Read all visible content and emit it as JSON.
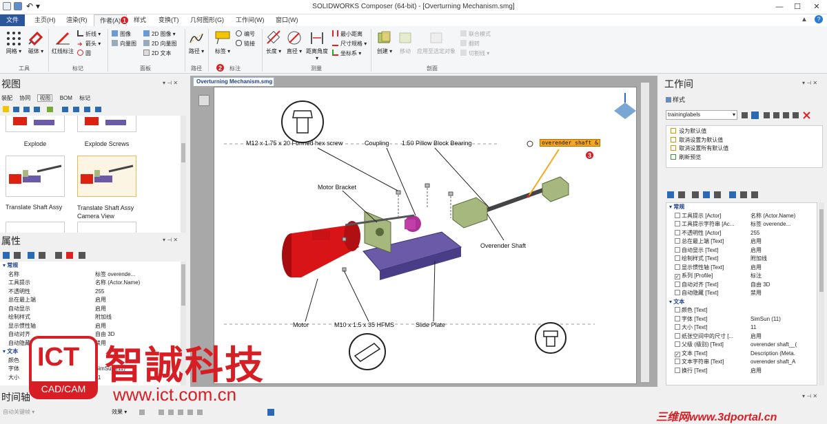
{
  "window": {
    "title": "SOLIDWORKS Composer (64-bit) - [Overturning Mechanism.smg]"
  },
  "menu": {
    "tabs": [
      "文件",
      "主页(H)",
      "渲染(R)",
      "作者(A)",
      "样式",
      "变换(T)",
      "几何图形(G)",
      "工作间(W)",
      "窗口(W)"
    ],
    "badge1": "1"
  },
  "ribbon": {
    "tools": {
      "mesh": "网格",
      "magnet": "磁体",
      "label": "工具"
    },
    "markup": {
      "redline": "红线标注",
      "polyline": "折线",
      "arrow": "箭头",
      "circle": "圆",
      "label": "标记"
    },
    "panel": {
      "image": "图像",
      "vector": "向量图",
      "img2d": "2D 图像",
      "vec2d": "2D 向量图",
      "text2d": "2D 文本",
      "label": "面板"
    },
    "path": {
      "path": "路径",
      "label": "路径"
    },
    "annot": {
      "label_btn": "标签",
      "number": "编号",
      "link": "链接",
      "label": "标注",
      "badge2": "2"
    },
    "measure": {
      "length": "长度",
      "diameter": "直径",
      "distangle": "距离角度",
      "mindist": "最小距离",
      "dimspec": "尺寸规格",
      "coord": "坐标系",
      "label": "测量"
    },
    "section": {
      "create": "创建",
      "move": "移动",
      "apply": "应用至选定对象",
      "joint": "联合模式",
      "flip": "翻转",
      "cutline": "切割线",
      "label": "剖面"
    }
  },
  "views_panel": {
    "title": "视图",
    "tabs": [
      "装配",
      "协同",
      "视图",
      "BOM",
      "标记"
    ],
    "items": [
      {
        "label": "Explode"
      },
      {
        "label": "Explode Screws"
      },
      {
        "label": "Translate Shaft Assy"
      },
      {
        "label": "Translate Shaft Assy Camera View"
      }
    ]
  },
  "props_panel": {
    "title": "属性",
    "section": "常规",
    "rows": [
      {
        "k": "名称",
        "v": "标签  overende..."
      },
      {
        "k": "工具提示",
        "v": "名称 (Actor.Name)"
      },
      {
        "k": "不透明性",
        "v": "255"
      },
      {
        "k": "总在最上端",
        "v": "启用"
      },
      {
        "k": "自动显示",
        "v": "启用"
      },
      {
        "k": "绘制样式",
        "v": "附加线"
      },
      {
        "k": "显示惯性轴",
        "v": "启用"
      },
      {
        "k": "自动对齐",
        "v": "自由 3D"
      },
      {
        "k": "自动隐藏",
        "v": "禁用"
      }
    ],
    "text_section": "文本",
    "text_rows": [
      {
        "k": "颜色",
        "v": ""
      },
      {
        "k": "字体",
        "v": "SimSun (11)"
      },
      {
        "k": "大小",
        "v": "11"
      }
    ]
  },
  "doc": {
    "tab": "Overturning Mechanism.smg"
  },
  "callouts": {
    "screw_top": "M12 x 1.75 x 20 Formed hex screw",
    "coupling": "Coupling",
    "bearing": "1:50 Pillow Block Bearing",
    "selected": "overender shaft &",
    "badge3": "3",
    "motor_bracket": "Motor Bracket",
    "overender": "Overender Shaft",
    "motor": "Motor",
    "hfms": "M10 x 1.5 x 35 HFMS",
    "slide": "Slide Plate"
  },
  "workshop": {
    "title": "工作间",
    "style_label": "样式",
    "dropdown": "traininglabels",
    "actions": [
      "设为默认值",
      "取消设置为默认值",
      "取消设置所有默认值",
      "刷新预览"
    ],
    "section1": "常规",
    "rows": [
      {
        "k": "工具提示 [Actor]",
        "v": "名称 (Actor.Name)",
        "c": false
      },
      {
        "k": "工具提示字符串 [Ac...",
        "v": "标签 overende...",
        "c": false
      },
      {
        "k": "不透明性 [Actor]",
        "v": "255",
        "c": false
      },
      {
        "k": "总在最上端 [Text]",
        "v": "启用",
        "c": false
      },
      {
        "k": "自动显示 [Text]",
        "v": "启用",
        "c": false
      },
      {
        "k": "绘制样式 [Text]",
        "v": "附加线",
        "c": false
      },
      {
        "k": "显示惯性轴 [Text]",
        "v": "启用",
        "c": false
      },
      {
        "k": "系列 [Profile]",
        "v": "标注",
        "c": true
      },
      {
        "k": "自动对齐 [Text]",
        "v": "自由 3D",
        "c": false
      },
      {
        "k": "自动隐藏 [Text]",
        "v": "禁用",
        "c": false
      }
    ],
    "section2": "文本",
    "text_rows": [
      {
        "k": "颜色 [Text]",
        "v": "",
        "c": false
      },
      {
        "k": "字体 [Text]",
        "v": "SimSun (11)",
        "c": false
      },
      {
        "k": "大小 [Text]",
        "v": "11",
        "c": false
      },
      {
        "k": "纸张空间中的尺寸 [...",
        "v": "启用",
        "c": false
      },
      {
        "k": "父级 (级别) [Text]",
        "v": "overender shaft__(",
        "c": false
      },
      {
        "k": "文本 [Text]",
        "v": "Description (Meta.",
        "c": true
      },
      {
        "k": "文本字符串 [Text]",
        "v": "overender shaft_A",
        "c": false
      },
      {
        "k": "换行 [Text]",
        "v": "启用",
        "c": false
      }
    ]
  },
  "timeline": {
    "title": "时间轴",
    "auto_key": "自动关键帧",
    "effects": "效果"
  },
  "watermark": {
    "ict": "ICT",
    "cadcam": "CAD/CAM",
    "company": "智誠科技",
    "url": "www.ict.com.cn",
    "portal": "三维网www.3dportal.cn"
  },
  "colors": {
    "accent": "#2b579a",
    "badge": "#d81e25",
    "motor": "#d81417",
    "plate": "#6a5aa8",
    "bracket": "#a7b87e",
    "coupling": "#b0309a",
    "selected_bg": "#f7a71c"
  }
}
